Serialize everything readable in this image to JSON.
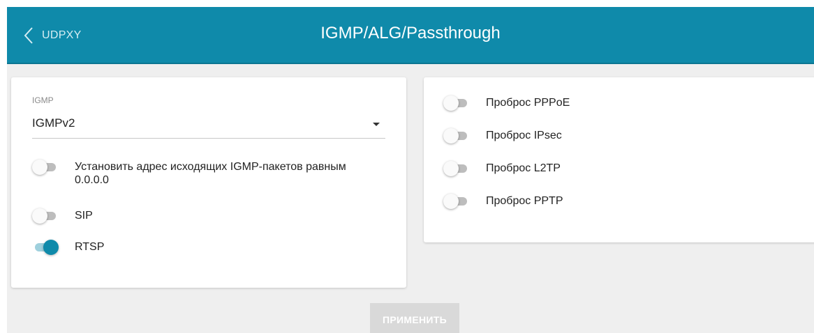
{
  "header": {
    "back_label": "UDPXY",
    "title": "IGMP/ALG/Passthrough",
    "accent_color": "#0f8aaa"
  },
  "left_card": {
    "igmp_select": {
      "label": "IGMP",
      "value": "IGMPv2"
    },
    "toggles": [
      {
        "label": "Установить адрес исходящих IGMP-пакетов равным 0.0.0.0",
        "on": false
      },
      {
        "label": "SIP",
        "on": false
      },
      {
        "label": "RTSP",
        "on": true
      }
    ]
  },
  "right_card": {
    "toggles": [
      {
        "label": "Проброс PPPoE",
        "on": false
      },
      {
        "label": "Проброс IPsec",
        "on": false
      },
      {
        "label": "Проброс L2TP",
        "on": false
      },
      {
        "label": "Проброс PPTP",
        "on": false
      }
    ]
  },
  "apply_label": "ПРИМЕНИТЬ"
}
